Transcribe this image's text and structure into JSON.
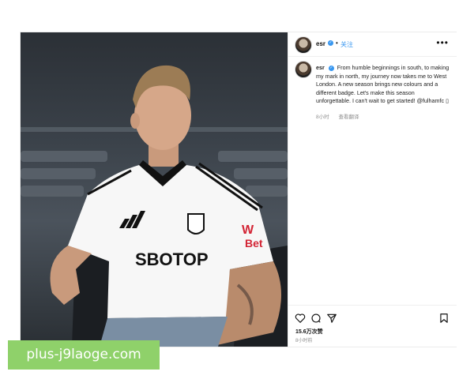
{
  "post": {
    "username": "esr",
    "follow_label": "关注",
    "dot": "•",
    "more_label": "•••",
    "caption": "From humble beginnings in south, to making my mark in north, my journey now takes me to West London. A new season brings new colours and a different badge. Let's make this season unforgettable. I can't wait to get started! @fulhamfc",
    "caption_emoji": "▯",
    "time_ago": "8小时",
    "translate_label": "查看翻译",
    "likes": "15.6万次赞",
    "posted_ago": "8小时前"
  },
  "photo": {
    "jersey_sponsor": "SBOTOP",
    "sleeve_sponsor_line1": "W",
    "sleeve_sponsor_line2": "Bet"
  },
  "watermark": {
    "text": "plus-j9laoge.com"
  },
  "icons": [
    "heart-icon",
    "comment-icon",
    "share-icon",
    "bookmark-icon",
    "more-icon",
    "verified-icon"
  ],
  "colors": {
    "accent": "#3897f0",
    "watermark_bg": "#8fd16a"
  }
}
